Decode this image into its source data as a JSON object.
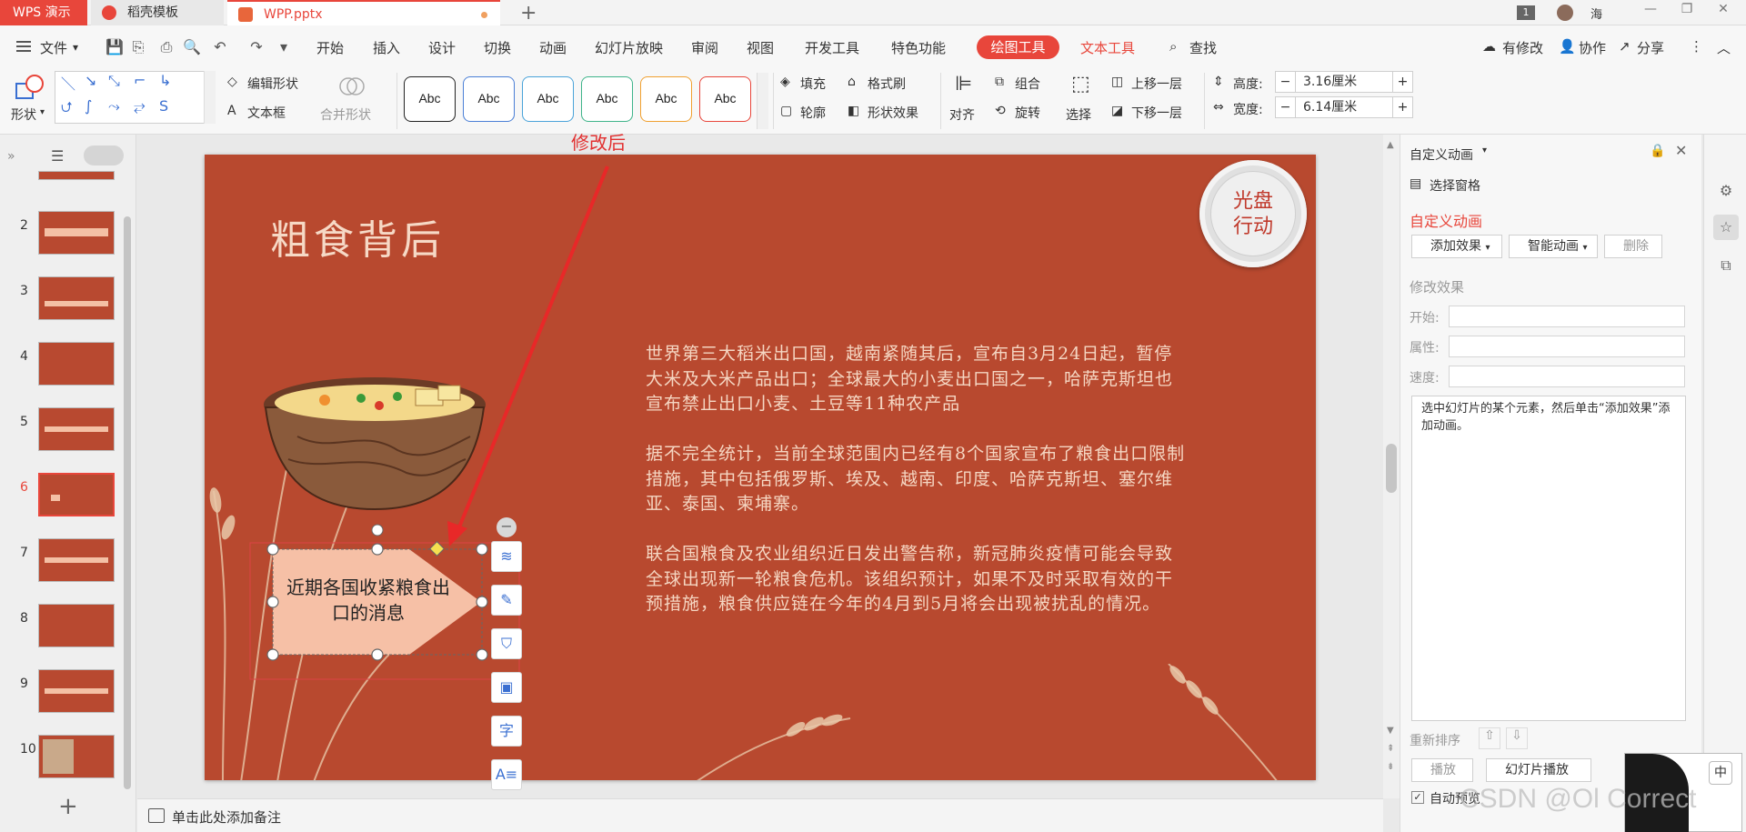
{
  "titlebar": {
    "app_tab": "WPS 演示",
    "tabs": [
      {
        "label": "稻壳模板"
      },
      {
        "label": "WPP.pptx"
      }
    ],
    "badge": "1",
    "user": "海"
  },
  "menu": {
    "file": "文件",
    "items": [
      "开始",
      "插入",
      "设计",
      "切换",
      "动画",
      "幻灯片放映",
      "审阅",
      "视图",
      "开发工具",
      "特色功能"
    ],
    "active": "绘图工具",
    "text_tools": "文本工具",
    "search": "查找",
    "modified": "有修改",
    "collab": "协作",
    "share": "分享"
  },
  "ribbon": {
    "shape": "形状",
    "edit_shape": "编辑形状",
    "textbox": "文本框",
    "merge_shape": "合并形状",
    "style_label": "Abc",
    "style_colors": [
      "#222222",
      "#4a7fd6",
      "#4aa3d9",
      "#3fb48a",
      "#f0a030",
      "#e8463b"
    ],
    "fill": "填充",
    "format_brush": "格式刷",
    "outline": "轮廓",
    "shape_effect": "形状效果",
    "align": "对齐",
    "group": "组合",
    "rotate": "旋转",
    "select": "选择",
    "bring_forward": "上移一层",
    "send_backward": "下移一层",
    "height_label": "高度:",
    "height_value": "3.16厘米",
    "width_label": "宽度:",
    "width_value": "6.14厘米"
  },
  "slides": {
    "numbers": [
      "2",
      "3",
      "4",
      "5",
      "6",
      "7",
      "8",
      "9",
      "10"
    ],
    "active": "6"
  },
  "slide": {
    "title": "粗食背后",
    "badge_line1": "光盘",
    "badge_line2": "行动",
    "para1": "世界第三大稻米出口国，越南紧随其后，宣布自3月24日起，暂停大米及大米产品出口；全球最大的小麦出口国之一，哈萨克斯坦也宣布禁止出口小麦、土豆等11种农产品",
    "para2": "据不完全统计，当前全球范围内已经有8个国家宣布了粮食出口限制措施，其中包括俄罗斯、埃及、越南、印度、哈萨克斯坦、塞尔维亚、泰国、柬埔寨。",
    "para3": "联合国粮食及农业组织近日发出警告称，新冠肺炎疫情可能会导致全球出现新一轮粮食危机。该组织预计，如果不及时采取有效的干预措施，粮食供应链在今年的4月到5月将会出现被扰乱的情况。",
    "arrow_text": "近期各国收紧粮食出口的消息"
  },
  "annotation": "修改后",
  "notes": "单击此处添加备注",
  "right_panel": {
    "header": "自定义动画",
    "selection_pane": "选择窗格",
    "section": "自定义动画",
    "add_effect": "添加效果",
    "smart_anim": "智能动画",
    "delete": "删除",
    "modify": "修改效果",
    "start": "开始:",
    "property": "属性:",
    "speed": "速度:",
    "hint": "选中幻灯片的某个元素，然后单击“添加效果”添加动画。",
    "reorder": "重新排序",
    "play": "播放",
    "slideshow": "幻灯片播放",
    "autopreview": "自动预览"
  },
  "ime": "中",
  "watermark": "CSDN @Ol Correct"
}
